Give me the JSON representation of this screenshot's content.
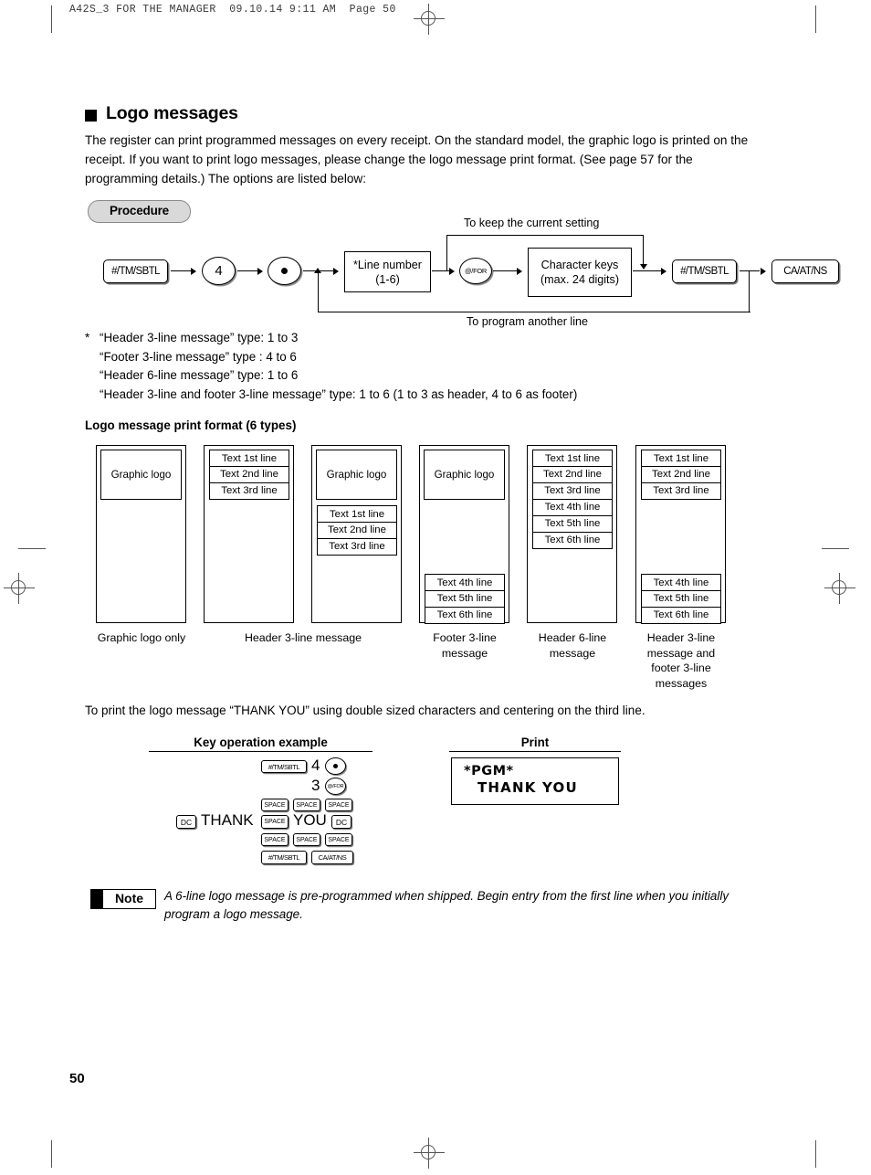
{
  "print_header": "A42S_3 FOR THE MANAGER  09.10.14 9:11 AM  Page 50",
  "section": {
    "title": "Logo messages",
    "intro": "The register can print programmed messages on every receipt. On the standard model, the graphic logo is printed on the receipt.  If you want to print logo messages, please change the logo message print format. (See page 57 for the programming details.)  The options are listed below:"
  },
  "procedure": {
    "label": "Procedure",
    "keys": {
      "sbtl": "#/TM/SBTL",
      "four": "4",
      "dot": "•",
      "line_number_l1": "*Line number",
      "line_number_l2": "(1-6)",
      "at_for": "@/FOR",
      "char_keys_l1": "Character keys",
      "char_keys_l2": "(max. 24 digits)",
      "sbtl2": "#/TM/SBTL",
      "ca_at_ns": "CA/AT/NS"
    },
    "branch_top": "To keep the current setting",
    "branch_bottom": "To program another line"
  },
  "footnotes": {
    "marker": "*",
    "lines": [
      "“Header 3-line message” type: 1 to 3",
      "“Footer 3-line message” type  : 4 to 6",
      "“Header 6-line message” type: 1 to 6",
      "“Header 3-line and footer 3-line message” type: 1 to 6 (1 to 3 as header, 4 to 6 as footer)"
    ]
  },
  "formats": {
    "title": "Logo message print format (6 types)",
    "graphic_logo_label": "Graphic logo",
    "lines": {
      "l1": "Text 1st line",
      "l2": "Text 2nd line",
      "l3": "Text 3rd line",
      "l4": "Text 4th line",
      "l5": "Text 5th line",
      "l6": "Text 6th line"
    },
    "captions": {
      "c1": "Graphic logo only",
      "c2": "Header 3-line message",
      "c3": "Footer 3-line message",
      "c4": "Header 6-line message",
      "c5": "Header 3-line message and footer 3-line messages"
    }
  },
  "example": {
    "lead": "To print the logo message “THANK YOU” using double sized characters and centering on the third line.",
    "col_left": "Key operation example",
    "col_right": "Print",
    "keys": {
      "sbtl": "#/TM/SBTL",
      "four": "4",
      "dot": "•",
      "three": "3",
      "at_for": "@/FOR",
      "space": "SPACE",
      "dc": "DC",
      "thank": "THANK",
      "you": "YOU",
      "ca_at_ns": "CA/AT/NS"
    },
    "print": {
      "line1": "*PGM*",
      "line2": "THANK  YOU"
    }
  },
  "note": {
    "badge": "Note",
    "text": "A 6-line logo message is pre-programmed when shipped.  Begin entry from the first line when you initially program a logo message."
  },
  "page_number": "50"
}
